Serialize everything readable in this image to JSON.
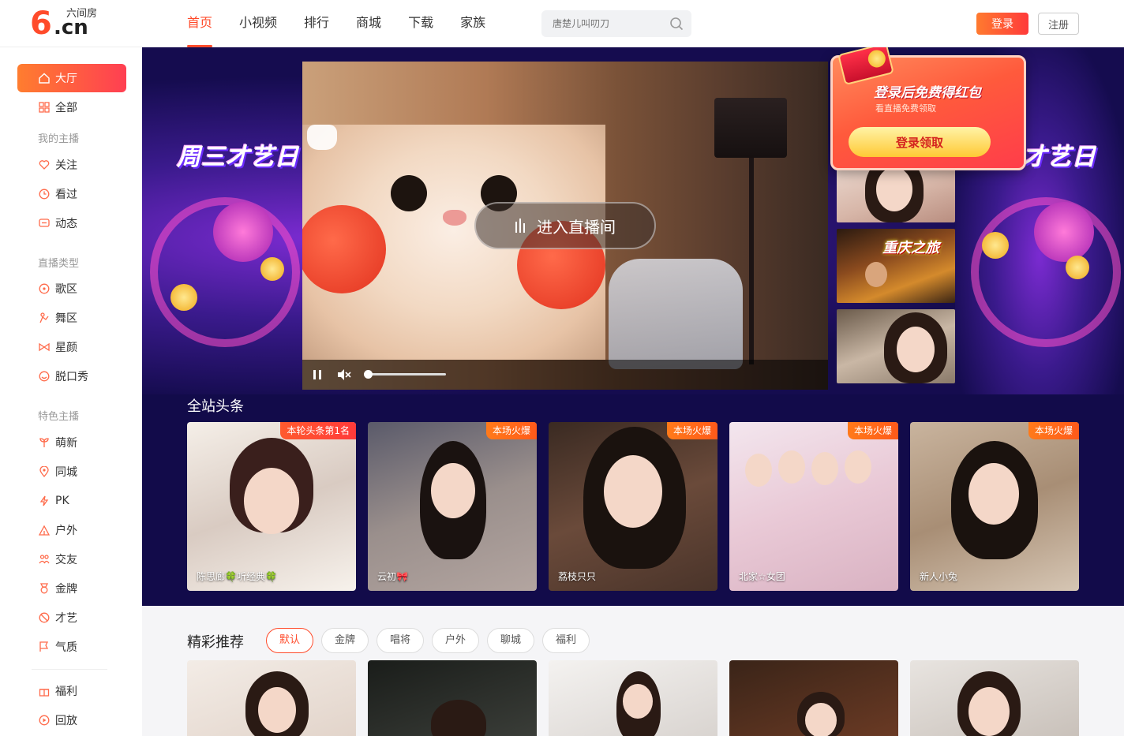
{
  "logo": {
    "brand_cn": "六间房",
    "domain": ".cn",
    "six": "6"
  },
  "nav": {
    "items": [
      "首页",
      "小视频",
      "排行",
      "商城",
      "下载",
      "家族"
    ],
    "active_index": 0
  },
  "search": {
    "placeholder": "唐楚儿叫叨刀"
  },
  "auth": {
    "login": "登录",
    "register": "注册"
  },
  "sidebar": {
    "hall": "大厅",
    "all": "全部",
    "group_my": "我的主播",
    "my": [
      "关注",
      "看过",
      "动态"
    ],
    "group_type": "直播类型",
    "types": [
      "歌区",
      "舞区",
      "星颜",
      "脱口秀"
    ],
    "group_featured": "特色主播",
    "featured": [
      "萌新",
      "同城",
      "PK",
      "户外",
      "交友",
      "金牌",
      "才艺",
      "气质"
    ],
    "extra": [
      "福利",
      "回放"
    ]
  },
  "banner": {
    "promo_title": "周三才艺日",
    "promo_title_right": "才艺日",
    "enter_live": "进入直播间",
    "thumb2_text": "重庆之旅",
    "volume": 0.05
  },
  "packet": {
    "title": "登录后免费得红包",
    "subtitle": "看直播免费领取",
    "button": "登录领取"
  },
  "headline": {
    "title": "全站头条",
    "cards": [
      {
        "tag": "本轮头条第1名",
        "name": "陈思廊🍀听经典🍀"
      },
      {
        "tag": "本场火爆",
        "name": "云初🎀"
      },
      {
        "tag": "本场火爆",
        "name": "荔枝只只"
      },
      {
        "tag": "本场火爆",
        "name": "北家☆女团"
      },
      {
        "tag": "本场火爆",
        "name": "新人小兔"
      }
    ]
  },
  "recommend": {
    "title": "精彩推荐",
    "chips": [
      "默认",
      "金牌",
      "唱将",
      "户外",
      "聊城",
      "福利"
    ],
    "active_index": 0
  },
  "colors": {
    "accent": "#ff4b2b",
    "banner_bg": "#150c4f"
  }
}
